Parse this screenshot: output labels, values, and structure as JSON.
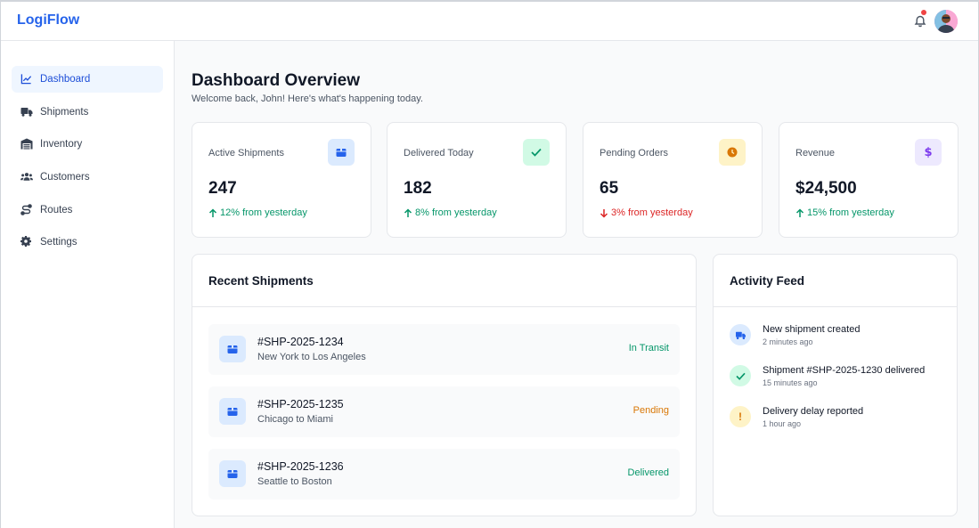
{
  "app": {
    "name": "LogiFlow"
  },
  "header": {
    "bell_icon": "bell-icon",
    "avatar_icon": "user-avatar"
  },
  "sidebar": {
    "items": [
      {
        "label": "Dashboard",
        "icon": "chart-line-icon",
        "active": true
      },
      {
        "label": "Shipments",
        "icon": "truck-icon"
      },
      {
        "label": "Inventory",
        "icon": "warehouse-icon"
      },
      {
        "label": "Customers",
        "icon": "users-icon"
      },
      {
        "label": "Routes",
        "icon": "route-icon"
      },
      {
        "label": "Settings",
        "icon": "gear-icon"
      }
    ]
  },
  "main": {
    "title": "Dashboard Overview",
    "subtitle": "Welcome back, John! Here's what's happening today."
  },
  "stats": [
    {
      "label": "Active Shipments",
      "value": "247",
      "change": "12% from yesterday",
      "trend": "up",
      "icon": "box-icon",
      "icon_color": "#2563eb",
      "icon_bg": "#dbeafe"
    },
    {
      "label": "Delivered Today",
      "value": "182",
      "change": "8% from yesterday",
      "trend": "up",
      "icon": "check-icon",
      "icon_color": "#059669",
      "icon_bg": "#d1fae5"
    },
    {
      "label": "Pending Orders",
      "value": "65",
      "change": "3% from yesterday",
      "trend": "down",
      "icon": "clock-icon",
      "icon_color": "#d97706",
      "icon_bg": "#fef3c7"
    },
    {
      "label": "Revenue",
      "value": "$24,500",
      "change": "15% from yesterday",
      "trend": "up",
      "icon": "dollar-icon",
      "icon_color": "#7c3aed",
      "icon_bg": "#ede9fe"
    }
  ],
  "recent_shipments": {
    "title": "Recent Shipments",
    "rows": [
      {
        "id": "#SHP-2025-1234",
        "route": "New York to Los Angeles",
        "status": "In Transit",
        "status_color": "#059669"
      },
      {
        "id": "#SHP-2025-1235",
        "route": "Chicago to Miami",
        "status": "Pending",
        "status_color": "#d97706"
      },
      {
        "id": "#SHP-2025-1236",
        "route": "Seattle to Boston",
        "status": "Delivered",
        "status_color": "#059669"
      }
    ]
  },
  "activity_feed": {
    "title": "Activity Feed",
    "items": [
      {
        "text": "New shipment created",
        "time": "2 minutes ago",
        "icon": "truck-icon",
        "icon_color": "#2563eb",
        "icon_bg": "#dbeafe"
      },
      {
        "text": "Shipment #SHP-2025-1230 delivered",
        "time": "15 minutes ago",
        "icon": "check-icon",
        "icon_color": "#059669",
        "icon_bg": "#d1fae5"
      },
      {
        "text": "Delivery delay reported",
        "time": "1 hour ago",
        "icon": "exclamation-icon",
        "icon_color": "#d97706",
        "icon_bg": "#fef3c7"
      }
    ]
  }
}
